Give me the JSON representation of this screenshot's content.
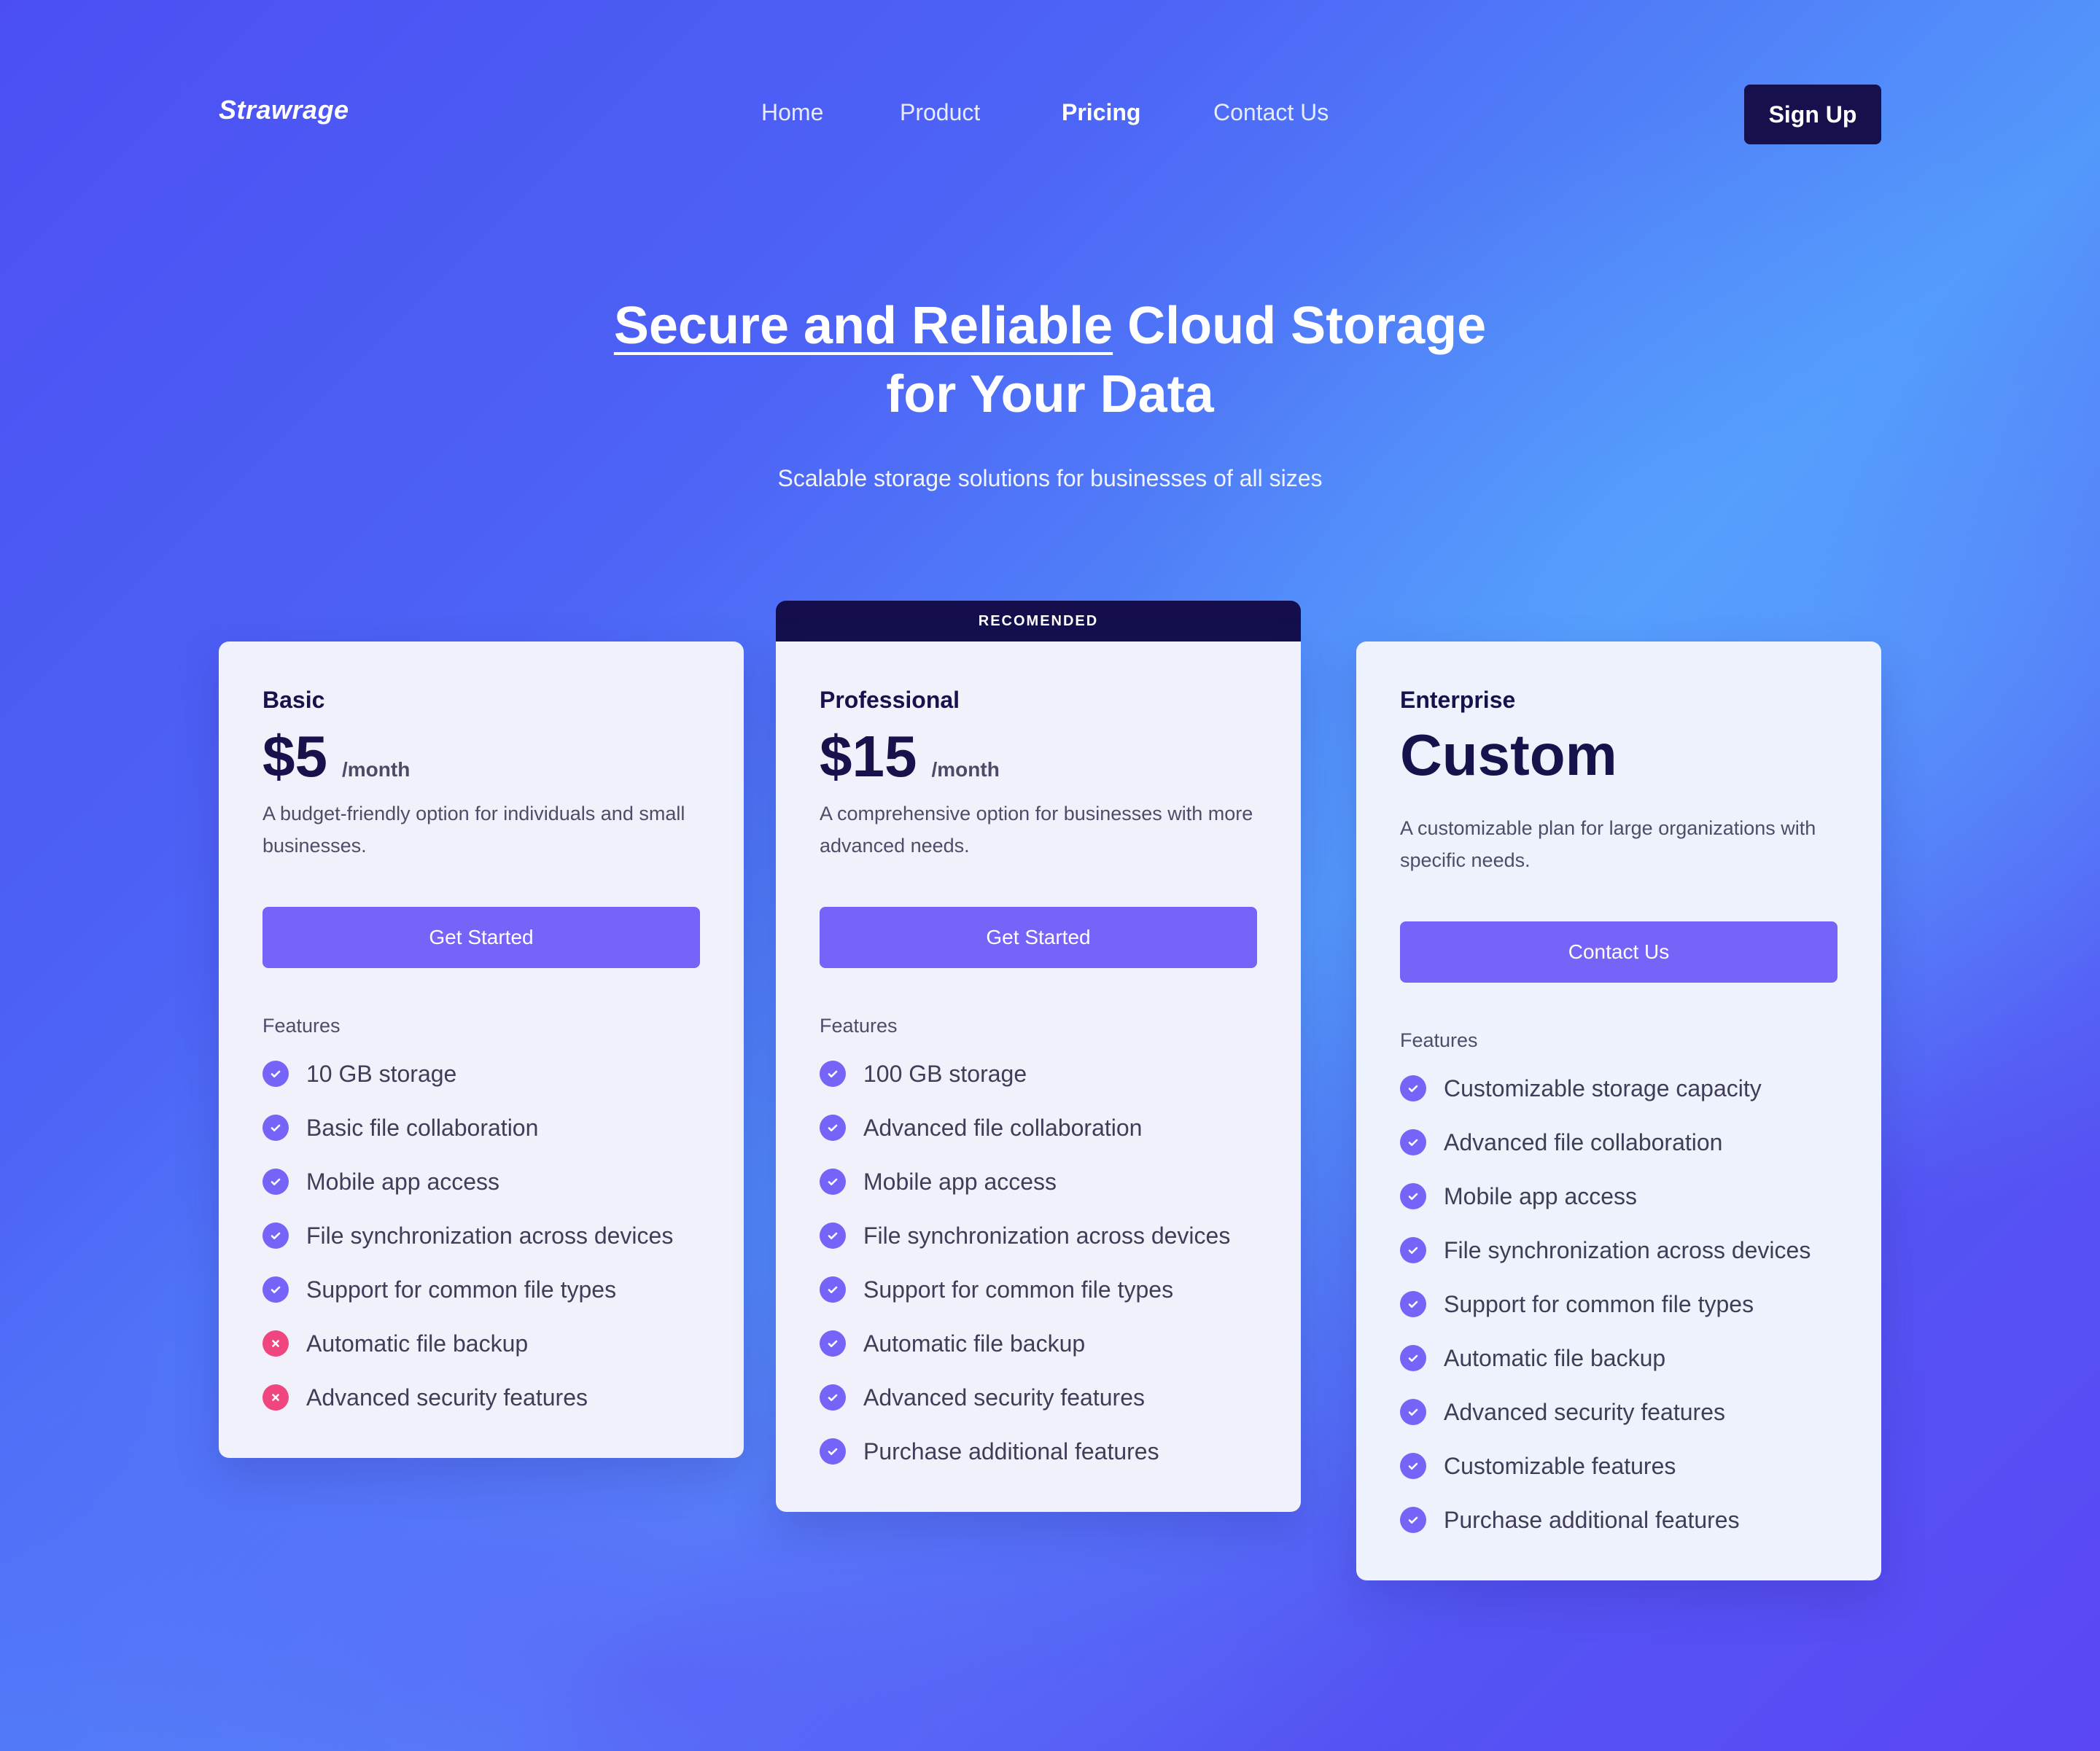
{
  "brand": {
    "logo": "Strawrage"
  },
  "nav": {
    "items": [
      {
        "label": "Home",
        "active": false
      },
      {
        "label": "Product",
        "active": false
      },
      {
        "label": "Pricing",
        "active": true
      },
      {
        "label": "Contact Us",
        "active": false
      }
    ],
    "signup_label": "Sign Up"
  },
  "hero": {
    "title_highlight": "Secure and Reliable",
    "title_rest": "Cloud Storage",
    "title_line2": "for Your Data",
    "subtitle": "Scalable storage solutions for businesses of all sizes"
  },
  "plans": [
    {
      "name": "Basic",
      "price": "$5",
      "period": "/month",
      "description": "A budget-friendly option for individuals and small businesses.",
      "cta": "Get Started",
      "features_title": "Features",
      "features": [
        {
          "label": "10 GB storage",
          "included": true
        },
        {
          "label": "Basic file collaboration",
          "included": true
        },
        {
          "label": "Mobile app access",
          "included": true
        },
        {
          "label": "File synchronization across devices",
          "included": true
        },
        {
          "label": "Support for common file types",
          "included": true
        },
        {
          "label": "Automatic file backup",
          "included": false
        },
        {
          "label": "Advanced security features",
          "included": false
        }
      ]
    },
    {
      "name": "Professional",
      "badge": "RECOMENDED",
      "price": "$15",
      "period": "/month",
      "description": "A comprehensive option for businesses with more advanced needs.",
      "cta": "Get Started",
      "features_title": "Features",
      "features": [
        {
          "label": "100 GB storage",
          "included": true
        },
        {
          "label": "Advanced file collaboration",
          "included": true
        },
        {
          "label": "Mobile app access",
          "included": true
        },
        {
          "label": "File synchronization across devices",
          "included": true
        },
        {
          "label": "Support for common file types",
          "included": true
        },
        {
          "label": "Automatic file backup",
          "included": true
        },
        {
          "label": "Advanced security features",
          "included": true
        },
        {
          "label": "Purchase additional features",
          "included": true
        }
      ]
    },
    {
      "name": "Enterprise",
      "price": "Custom",
      "description": "A customizable plan for large organizations with specific needs.",
      "cta": "Contact Us",
      "features_title": "Features",
      "features": [
        {
          "label": "Customizable storage capacity",
          "included": true
        },
        {
          "label": "Advanced file collaboration",
          "included": true
        },
        {
          "label": "Mobile app access",
          "included": true
        },
        {
          "label": "File synchronization across devices",
          "included": true
        },
        {
          "label": "Support for common file types",
          "included": true
        },
        {
          "label": "Automatic file backup",
          "included": true
        },
        {
          "label": "Advanced security features",
          "included": true
        },
        {
          "label": "Customizable features",
          "included": true
        },
        {
          "label": "Purchase additional features",
          "included": true
        }
      ]
    }
  ],
  "colors": {
    "accent": "#7663f7",
    "dark": "#16104d",
    "excluded": "#f0467f"
  },
  "icons": {
    "included": "check-circle-icon",
    "excluded": "x-circle-icon"
  }
}
